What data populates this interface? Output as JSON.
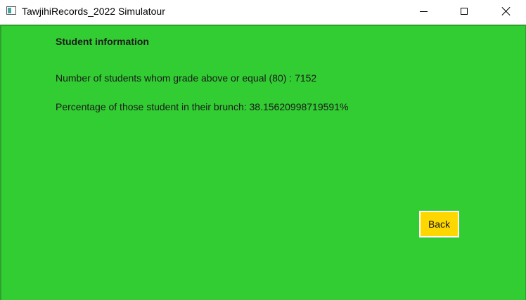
{
  "window": {
    "title": "TawjihiRecords_2022 Simulatour",
    "icon": "app-window-icon",
    "controls": [
      "minimize-icon",
      "maximize-icon",
      "close-icon"
    ]
  },
  "content": {
    "heading": "Student information",
    "students_count_text": "Number of students whom grade above or equal (80) :  7152",
    "percentage_text": "Percentage of those student in their brunch: 38.15620998719591%",
    "back_button_label": "Back"
  },
  "colors": {
    "background": "#32cd32",
    "button": "#ffd700",
    "button_border": "#ffffff"
  }
}
